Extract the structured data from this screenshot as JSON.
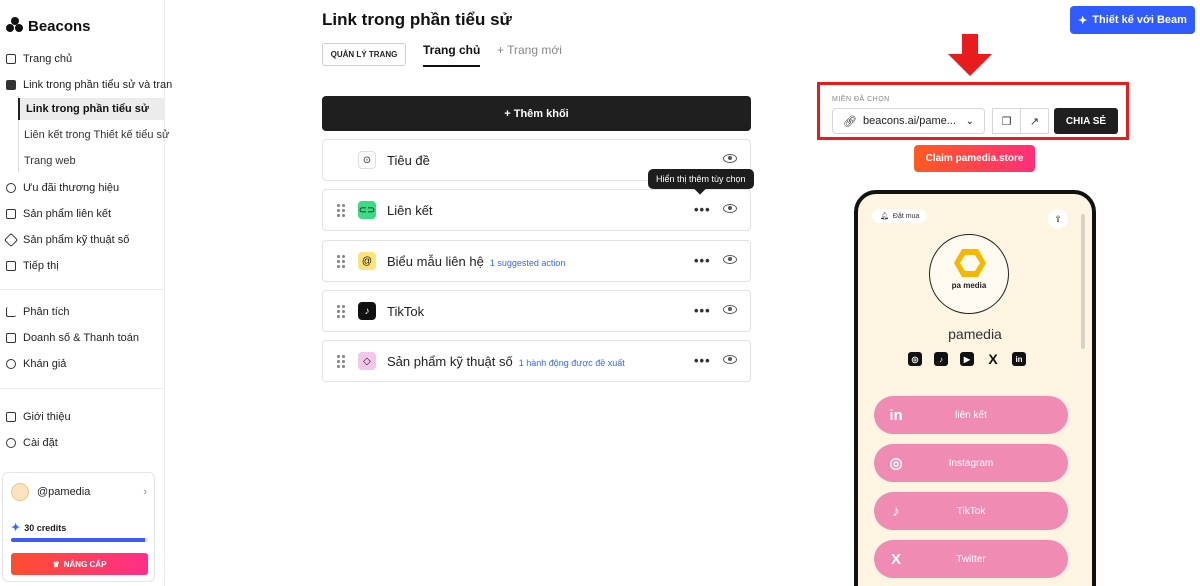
{
  "brand": {
    "name": "Beacons"
  },
  "sidebar": {
    "items": [
      {
        "label": "Trang chủ"
      },
      {
        "label": "Link trong phần tiểu sử và tran"
      },
      {
        "label": "Ưu đãi thương hiệu"
      },
      {
        "label": "Sản phẩm liên kết"
      },
      {
        "label": "Sản phẩm kỹ thuật số"
      },
      {
        "label": "Tiếp thị"
      },
      {
        "label": "Phân tích"
      },
      {
        "label": "Doanh số & Thanh toán"
      },
      {
        "label": "Khán giả"
      },
      {
        "label": "Giới thiệu"
      },
      {
        "label": "Cài đặt"
      }
    ],
    "sub_items": [
      {
        "label": "Link trong phần tiểu sử"
      },
      {
        "label": "Liên kết trong Thiết kế tiểu sử"
      },
      {
        "label": "Trang web"
      }
    ],
    "profile": {
      "handle": "@pamedia",
      "credits": "30 credits",
      "credits_fill": 0.98,
      "upgrade": "NÂNG CẤP"
    }
  },
  "main": {
    "title": "Link trong phần tiểu sử",
    "manage_button": "QUẢN LÝ TRANG",
    "tabs": [
      {
        "label": "Trang chủ"
      },
      {
        "label": "+ Trang mới"
      }
    ],
    "add_block": "+ Thêm khối",
    "tooltip": "Hiển thị thêm tùy chọn",
    "blocks": [
      {
        "title": "Tiêu đề",
        "suggestion": ""
      },
      {
        "title": "Liên kết",
        "suggestion": ""
      },
      {
        "title": "Biểu mẫu liên hệ",
        "suggestion": "1 suggested action"
      },
      {
        "title": "TikTok",
        "suggestion": ""
      },
      {
        "title": "Sản phẩm kỹ thuật số",
        "suggestion": "1 hành động được đề xuất"
      }
    ]
  },
  "right": {
    "beam_button": "Thiết kế với Beam",
    "domain_label": "MIỀN ĐÃ CHỌN",
    "domain_value": "beacons.ai/pame...",
    "share_button": "CHIA SẺ",
    "claim_button": "Claim pamedia.store",
    "phone": {
      "order_label": "Đặt mua",
      "logo_text": "pa media",
      "profile_name": "pamedia",
      "link_buttons": [
        {
          "label": "liên kết",
          "icon": "in"
        },
        {
          "label": "Instagram",
          "icon": "◎"
        },
        {
          "label": "TikTok",
          "icon": "♪"
        },
        {
          "label": "Twitter",
          "icon": "X"
        }
      ]
    }
  },
  "colors": {
    "accent_blue": "#2f5bff",
    "highlight_red": "#e81c1c",
    "link_pink": "#f08cb4",
    "phone_bg": "#fdf4e1"
  }
}
